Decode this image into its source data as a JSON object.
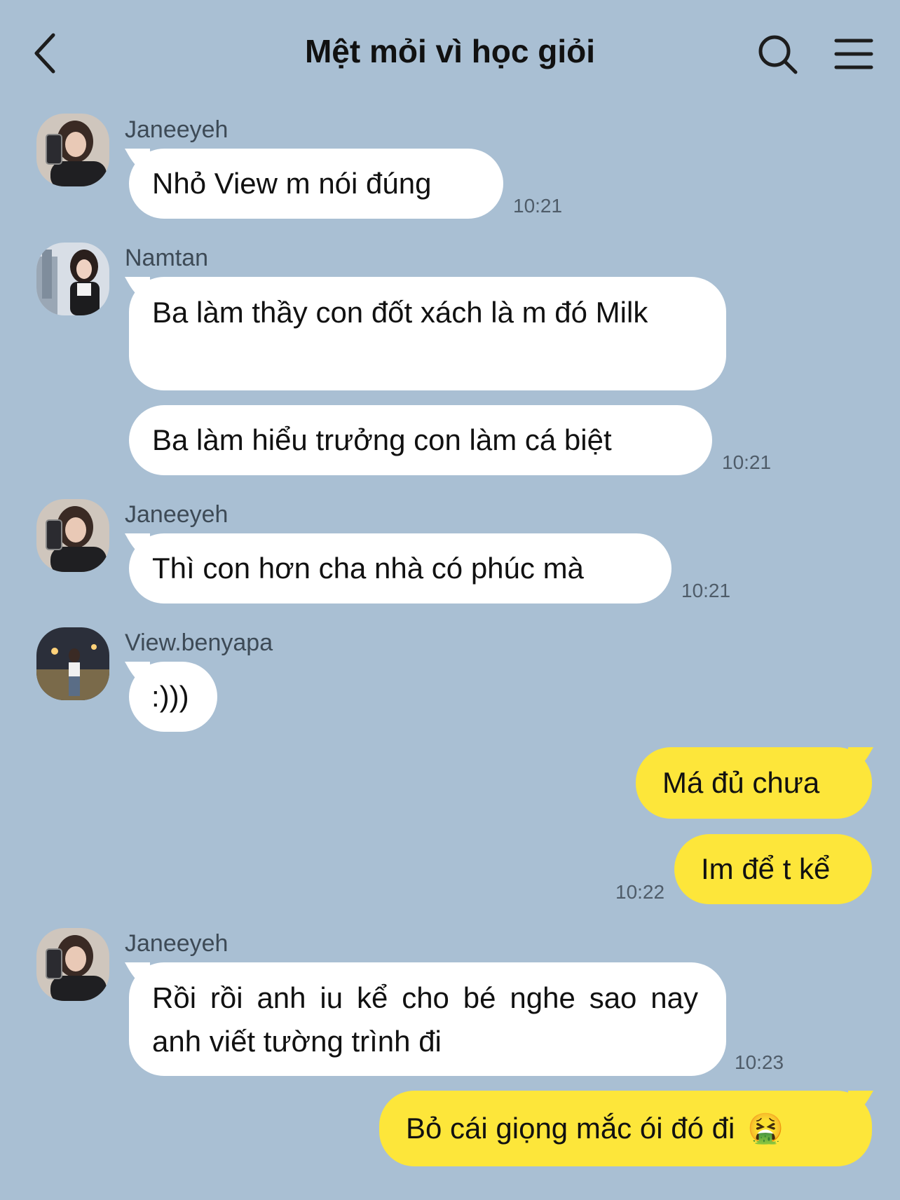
{
  "header": {
    "title": "Mệt mỏi vì học giỏi",
    "back_icon": "chevron-left-icon",
    "search_icon": "search-icon",
    "menu_icon": "menu-icon"
  },
  "colors": {
    "background": "#a9bfd3",
    "incoming_bubble": "#ffffff",
    "outgoing_bubble": "#fde63a"
  },
  "messages": [
    {
      "sender": "Janeeyeh",
      "text": "Nhỏ View m nói đúng",
      "time": "10:21"
    },
    {
      "sender": "Namtan",
      "text": "Ba làm thầy con đốt xách là m đó Milk",
      "time": ""
    },
    {
      "sender": "Namtan",
      "text": "Ba làm hiểu trưởng con làm cá biệt",
      "time": "10:21"
    },
    {
      "sender": "Janeeyeh",
      "text": "Thì con hơn cha nhà có phúc mà",
      "time": "10:21"
    },
    {
      "sender": "View.benyapa",
      "text": ":)))",
      "time": ""
    },
    {
      "sender": "me",
      "text": "Má đủ chưa",
      "time": ""
    },
    {
      "sender": "me",
      "text": "Im để t kể",
      "time": "10:22"
    },
    {
      "sender": "Janeeyeh",
      "text": "Rồi rồi anh iu kể cho bé nghe sao nay anh viết tường trình đi",
      "time": "10:23"
    },
    {
      "sender": "me",
      "text": "Bỏ cái giọng mắc ói đó đi",
      "emoji": "🤮",
      "time": ""
    }
  ]
}
